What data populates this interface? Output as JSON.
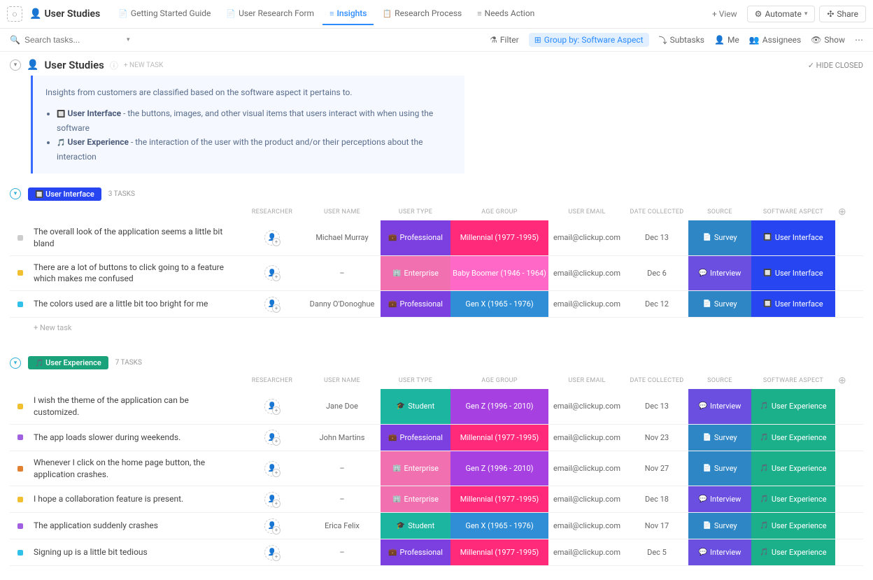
{
  "workspace": "User Studies",
  "nav_tabs": [
    {
      "label": "Getting Started Guide",
      "icon": "📄"
    },
    {
      "label": "User Research Form",
      "icon": "📄"
    },
    {
      "label": "Insights",
      "icon": "≡",
      "active": true
    },
    {
      "label": "Research Process",
      "icon": "📋"
    },
    {
      "label": "Needs Action",
      "icon": "≡"
    }
  ],
  "add_view": "+ View",
  "automate": "Automate",
  "share": "Share",
  "search_placeholder": "Search tasks...",
  "toolbar": {
    "filter": "Filter",
    "group_by": "Group by: Software Aspect",
    "subtasks": "Subtasks",
    "me": "Me",
    "assignees": "Assignees",
    "show": "Show"
  },
  "main_title": "User Studies",
  "new_task_label": "+ NEW TASK",
  "hide_closed": "HIDE CLOSED",
  "info": {
    "intro": "Insights from customers are classified based on the software aspect it pertains to.",
    "ui_bold": "User Interface",
    "ui_text": " - the buttons, images, and other visual items that users interact with when using the software",
    "ux_bold": "User Experience",
    "ux_text": " - the interaction of the user with the product and/or their perceptions about the interaction"
  },
  "columns": {
    "researcher": "RESEARCHER",
    "user_name": "USER NAME",
    "user_type": "USER TYPE",
    "age_group": "AGE GROUP",
    "user_email": "USER EMAIL",
    "date_collected": "DATE COLLECTED",
    "source": "SOURCE",
    "software_aspect": "SOFTWARE ASPECT"
  },
  "new_task_row": "+ New task",
  "colors": {
    "ui_pill": "#2745f0",
    "ux_pill": "#1aa37a",
    "professional": "#7c3fe0",
    "enterprise": "#f070b0",
    "student": "#1cb5a0",
    "millennial": "#ff2a7a",
    "baby_boomer": "#ff68c7",
    "gen_x": "#2f8ed6",
    "gen_z": "#a640e0",
    "survey": "#2f86c5",
    "interview": "#6a4fe0",
    "aspect_ui": "#2745f0",
    "aspect_ux": "#1bb08a",
    "dot_grey": "#cccccc",
    "dot_yellow": "#f0c030",
    "dot_cyan": "#30c0e8",
    "dot_purple": "#a060e0",
    "dot_orange": "#e08030"
  },
  "groups": [
    {
      "key": "ui",
      "pill": "User Interface",
      "pill_color": "ui_pill",
      "count": "3 TASKS",
      "rows": [
        {
          "dot": "dot_grey",
          "task": "The overall look of the application seems a little bit bland",
          "user_name": "Michael Murray",
          "user_type": {
            "label": "Professional",
            "color": "professional",
            "icon": "💼"
          },
          "age_group": {
            "label": "Millennial (1977 -1995)",
            "color": "millennial"
          },
          "email": "email@clickup.com",
          "date": "Dec 13",
          "source": {
            "label": "Survey",
            "color": "survey",
            "icon": "📄"
          },
          "aspect": {
            "label": "User Interface",
            "color": "aspect_ui",
            "icon": "🔲"
          }
        },
        {
          "dot": "dot_yellow",
          "task": "There are a lot of buttons to click going to a feature which makes me confused",
          "user_name": "–",
          "user_type": {
            "label": "Enterprise",
            "color": "enterprise",
            "icon": "🏢"
          },
          "age_group": {
            "label": "Baby Boomer (1946 - 1964)",
            "color": "baby_boomer"
          },
          "email": "email@clickup.com",
          "date": "Dec 6",
          "source": {
            "label": "Interview",
            "color": "interview",
            "icon": "💬"
          },
          "aspect": {
            "label": "User Interface",
            "color": "aspect_ui",
            "icon": "🔲"
          }
        },
        {
          "dot": "dot_cyan",
          "task": "The colors used are a little bit too bright for me",
          "user_name": "Danny O'Donoghue",
          "user_type": {
            "label": "Professional",
            "color": "professional",
            "icon": "💼"
          },
          "age_group": {
            "label": "Gen X (1965 - 1976)",
            "color": "gen_x"
          },
          "email": "email@clickup.com",
          "date": "Dec 12",
          "source": {
            "label": "Survey",
            "color": "survey",
            "icon": "📄"
          },
          "aspect": {
            "label": "User Interface",
            "color": "aspect_ui",
            "icon": "🔲"
          }
        }
      ]
    },
    {
      "key": "ux",
      "pill": "User Experience",
      "pill_color": "ux_pill",
      "count": "7 TASKS",
      "rows": [
        {
          "dot": "dot_yellow",
          "task": "I wish the theme of the application can be customized.",
          "user_name": "Jane Doe",
          "user_type": {
            "label": "Student",
            "color": "student",
            "icon": "🎓"
          },
          "age_group": {
            "label": "Gen Z (1996 - 2010)",
            "color": "gen_z"
          },
          "email": "email@clickup.com",
          "date": "Dec 13",
          "source": {
            "label": "Interview",
            "color": "interview",
            "icon": "💬"
          },
          "aspect": {
            "label": "User Experience",
            "color": "aspect_ux",
            "icon": "🎵"
          }
        },
        {
          "dot": "dot_purple",
          "task": "The app loads slower during weekends.",
          "user_name": "John Martins",
          "user_type": {
            "label": "Professional",
            "color": "professional",
            "icon": "💼"
          },
          "age_group": {
            "label": "Millennial (1977 -1995)",
            "color": "millennial"
          },
          "email": "email@clickup.com",
          "date": "Nov 23",
          "source": {
            "label": "Survey",
            "color": "survey",
            "icon": "📄"
          },
          "aspect": {
            "label": "User Experience",
            "color": "aspect_ux",
            "icon": "🎵"
          }
        },
        {
          "dot": "dot_orange",
          "task": "Whenever I click on the home page button, the application crashes.",
          "user_name": "–",
          "user_type": {
            "label": "Enterprise",
            "color": "enterprise",
            "icon": "🏢"
          },
          "age_group": {
            "label": "Gen Z (1996 - 2010)",
            "color": "gen_z"
          },
          "email": "email@clickup.com",
          "date": "Nov 27",
          "source": {
            "label": "Survey",
            "color": "survey",
            "icon": "📄"
          },
          "aspect": {
            "label": "User Experience",
            "color": "aspect_ux",
            "icon": "🎵"
          }
        },
        {
          "dot": "dot_yellow",
          "task": "I hope a collaboration feature is present.",
          "user_name": "–",
          "user_type": {
            "label": "Enterprise",
            "color": "enterprise",
            "icon": "🏢"
          },
          "age_group": {
            "label": "Millennial (1977 -1995)",
            "color": "millennial"
          },
          "email": "email@clickup.com",
          "date": "Dec 18",
          "source": {
            "label": "Interview",
            "color": "interview",
            "icon": "💬"
          },
          "aspect": {
            "label": "User Experience",
            "color": "aspect_ux",
            "icon": "🎵"
          }
        },
        {
          "dot": "dot_purple",
          "task": "The application suddenly crashes",
          "user_name": "Erica Felix",
          "user_type": {
            "label": "Student",
            "color": "student",
            "icon": "🎓"
          },
          "age_group": {
            "label": "Gen X (1965 - 1976)",
            "color": "gen_x"
          },
          "email": "email@clickup.com",
          "date": "Nov 17",
          "source": {
            "label": "Survey",
            "color": "survey",
            "icon": "📄"
          },
          "aspect": {
            "label": "User Experience",
            "color": "aspect_ux",
            "icon": "🎵"
          }
        },
        {
          "dot": "dot_cyan",
          "task": "Signing up is a little bit tedious",
          "user_name": "–",
          "user_type": {
            "label": "Professional",
            "color": "professional",
            "icon": "💼"
          },
          "age_group": {
            "label": "Millennial (1977 -1995)",
            "color": "millennial"
          },
          "email": "email@clickup.com",
          "date": "Dec 5",
          "source": {
            "label": "Interview",
            "color": "interview",
            "icon": "💬"
          },
          "aspect": {
            "label": "User Experience",
            "color": "aspect_ux",
            "icon": "🎵"
          }
        }
      ]
    }
  ]
}
